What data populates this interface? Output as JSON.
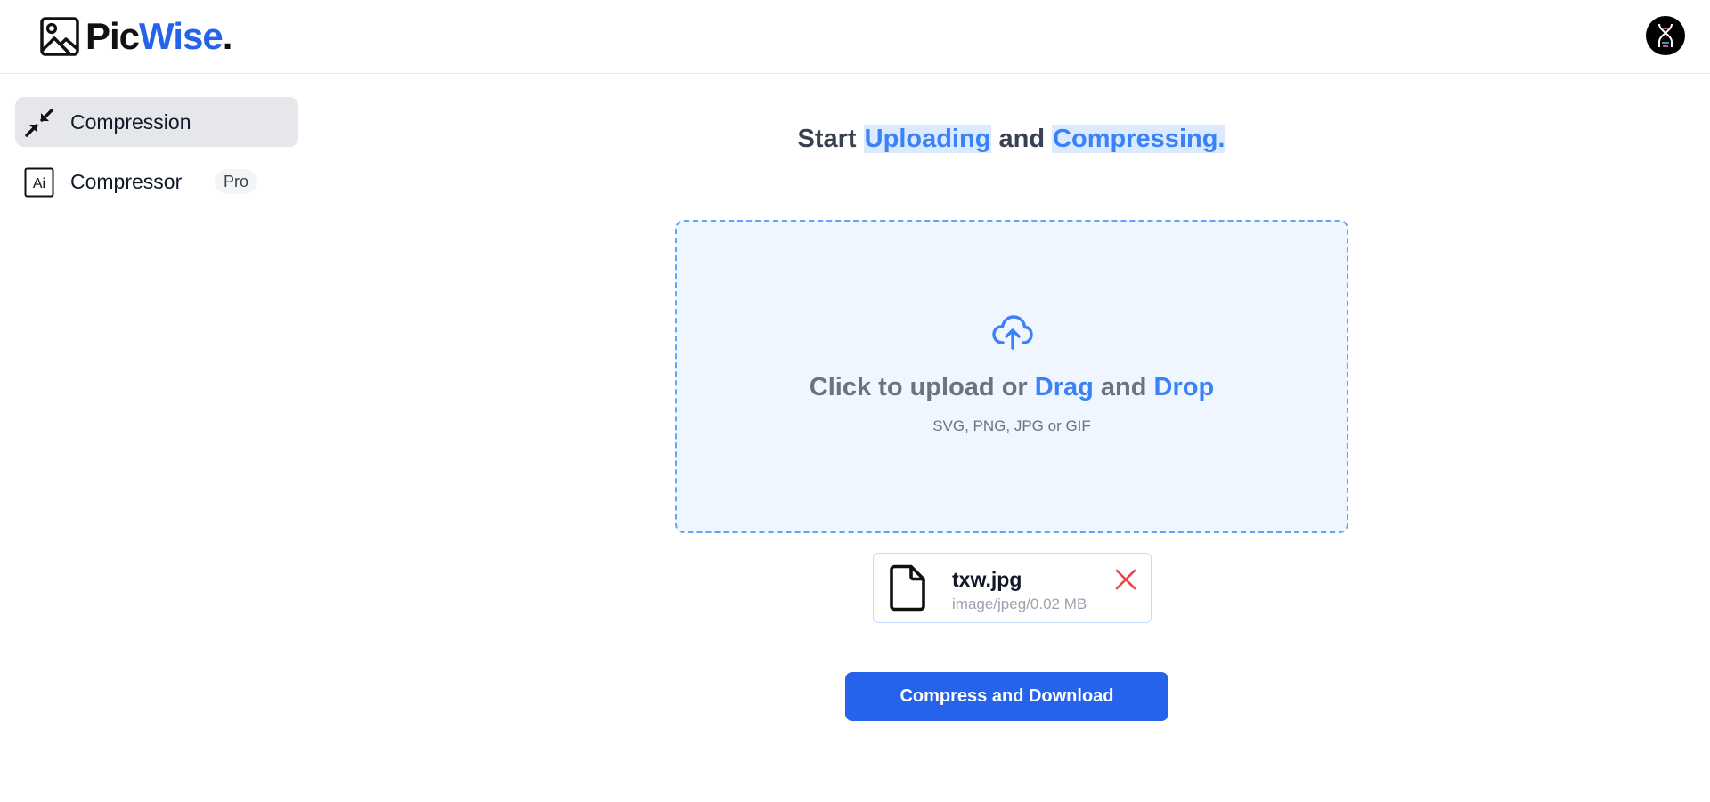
{
  "app": {
    "logo": {
      "pic": "Pic",
      "wise": "Wise",
      "dot": "."
    }
  },
  "header": {
    "avatar_icon": "dna-helix-icon"
  },
  "sidebar": {
    "items": [
      {
        "label": "Compression",
        "icon": "compress-arrows-icon",
        "active": true
      },
      {
        "label": "Compressor",
        "icon": "ai-icon",
        "icon_text": "Ai",
        "badge": "Pro",
        "active": false
      }
    ]
  },
  "main": {
    "headline": {
      "start": "Start",
      "uploading": "Uploading",
      "and": "and",
      "compressing": "Compressing."
    },
    "dropzone": {
      "icon": "cloud-upload-icon",
      "title_prefix": "Click to upload or",
      "drag": "Drag",
      "and": "and",
      "drop": "Drop",
      "subtitle": "SVG, PNG, JPG or GIF"
    },
    "file": {
      "name": "txw.jpg",
      "meta": "image/jpeg/0.02 MB",
      "icon": "file-icon",
      "remove_icon": "close-icon"
    },
    "action_button": "Compress and Download"
  },
  "colors": {
    "brand": "#2563eb",
    "accent_light": "#3b82f6",
    "highlight_bg": "#dbeafe",
    "dropzone_bg": "#eff6ff",
    "danger": "#ef4444"
  }
}
